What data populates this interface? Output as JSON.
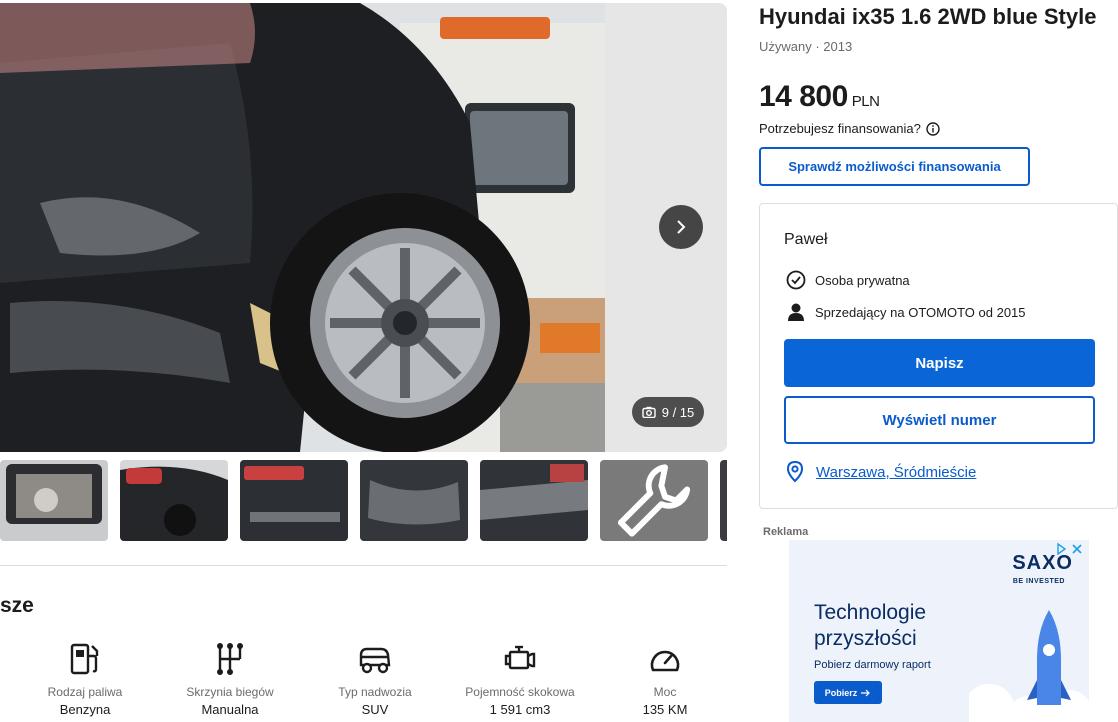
{
  "gallery": {
    "counter": "9 / 15",
    "next_label": "next photo",
    "thumb_count": 7
  },
  "section": {
    "title": "sze"
  },
  "specs": [
    {
      "icon": "fuel-pump-icon",
      "label": "Rodzaj paliwa",
      "value": "Benzyna"
    },
    {
      "icon": "gearbox-icon",
      "label": "Skrzynia biegów",
      "value": "Manualna"
    },
    {
      "icon": "car-body-icon",
      "label": "Typ nadwozia",
      "value": "SUV"
    },
    {
      "icon": "engine-icon",
      "label": "Pojemność skokowa",
      "value": "1 591 cm3"
    },
    {
      "icon": "speedometer-icon",
      "label": "Moc",
      "value": "135 KM"
    }
  ],
  "listing": {
    "title": "Hyundai ix35 1.6 2WD blue Style",
    "subtitle": "Używany · 2013",
    "price": "14 800",
    "currency": "PLN",
    "financing_question": "Potrzebujesz finansowania?",
    "financing_button": "Sprawdź możliwości finansowania"
  },
  "seller": {
    "name": "Paweł",
    "type": "Osoba prywatna",
    "since": "Sprzedający na OTOMOTO od 2015",
    "write_button": "Napisz",
    "phone_button": "Wyświetl numer",
    "location": "Warszawa, Śródmieście"
  },
  "ad": {
    "label": "Reklama",
    "brand": "SAXO",
    "brand_sub": "BE INVESTED",
    "headline": "Technologie przyszłości",
    "sub": "Pobierz darmowy raport",
    "cta": "Pobierz"
  },
  "colors": {
    "accent": "#0a66d6",
    "link": "#0a5ccc",
    "ad_navy": "#0b2d63"
  }
}
